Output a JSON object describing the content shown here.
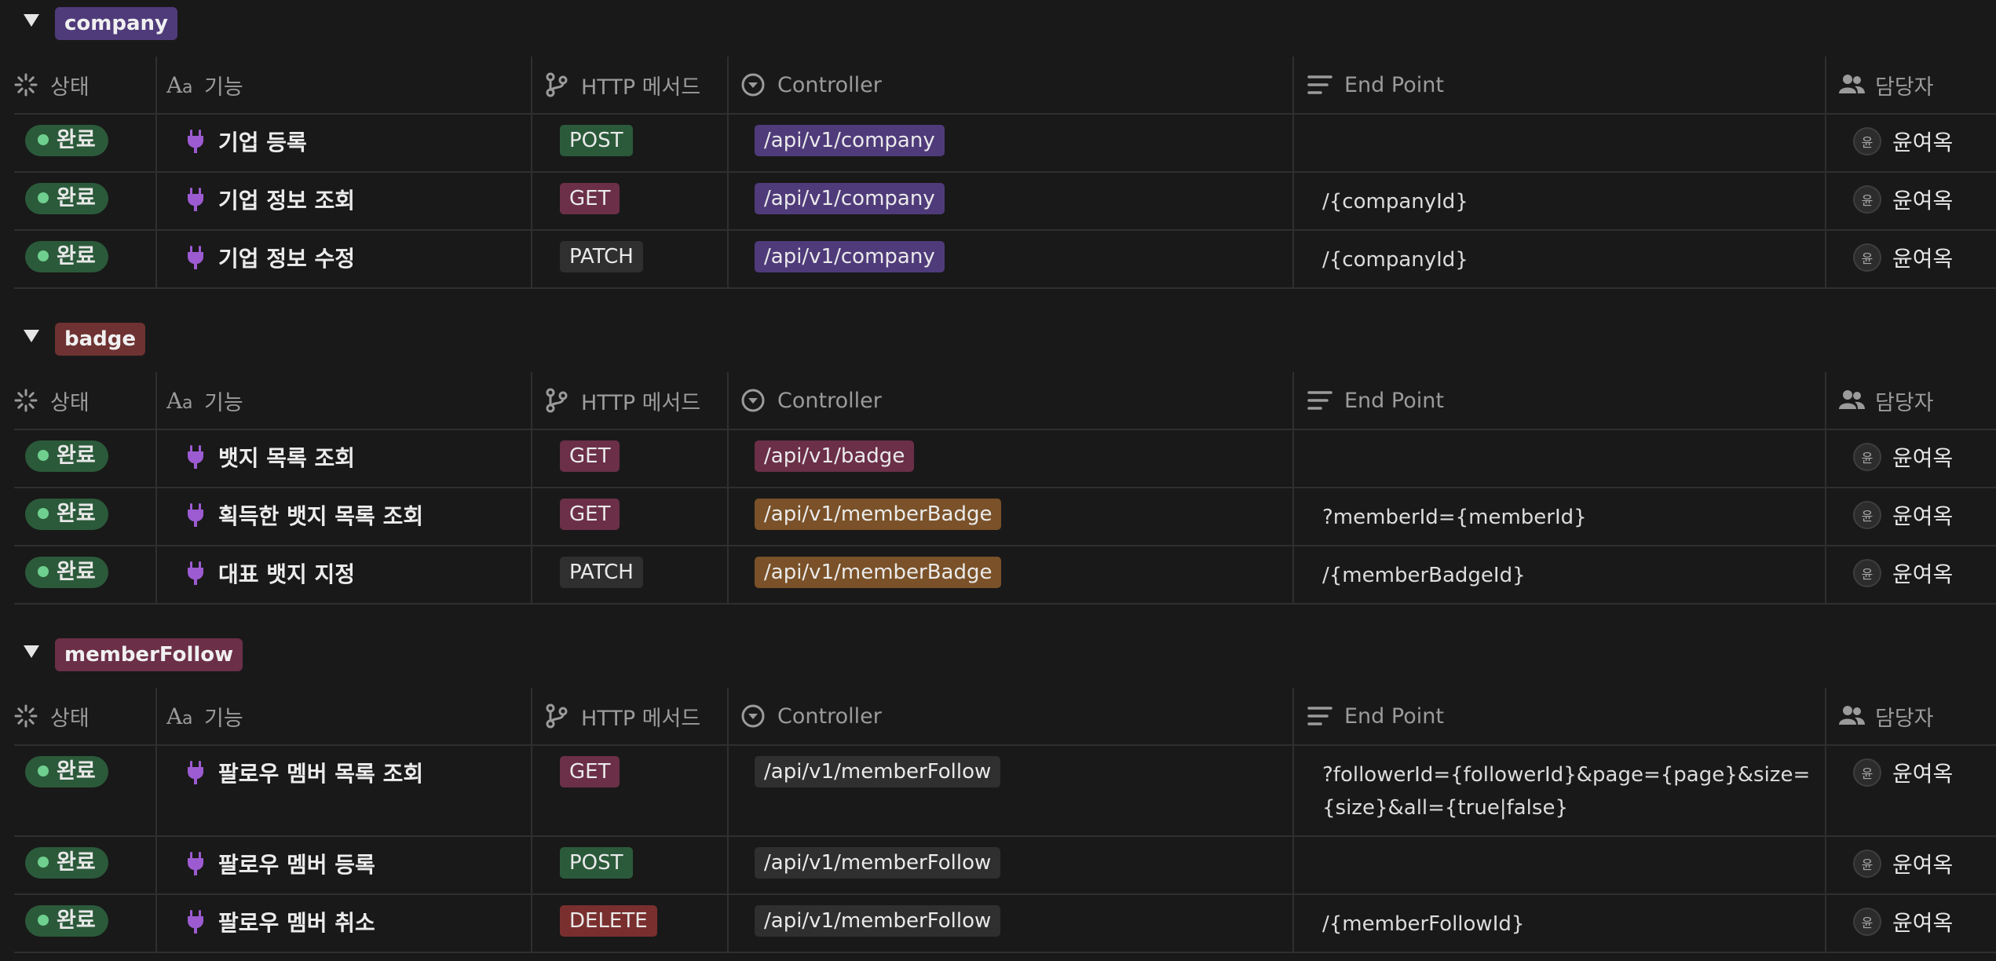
{
  "columns": {
    "status": "상태",
    "feature": "기능",
    "method": "HTTP 메서드",
    "controller": "Controller",
    "endpoint": "End Point",
    "assignee": "담당자"
  },
  "colors": {
    "background": "#191919",
    "status_done_bg": "#2b5a3a",
    "status_done_dot": "#6fcf8e",
    "plug_icon": "#9d5bd2",
    "method_post": "#2b5a3a",
    "method_get": "#6b2f47",
    "method_patch": "#2f2f2f",
    "method_delete": "#7a2f2f",
    "controller_company": "#4f3b7a",
    "controller_badge": "#6b2f47",
    "controller_memberBadge": "#7a5128",
    "controller_memberFollow": "#2f2f2f",
    "group_company": "#4f3b7a",
    "group_badge": "#6e3232",
    "group_memberFollow": "#6b2f47"
  },
  "groups": [
    {
      "name": "company",
      "rows": [
        {
          "status": "완료",
          "feature": "기업 등록",
          "method": "POST",
          "controller": "/api/v1/company",
          "endpoint": "",
          "assignee": "윤여옥",
          "avatar": "윤"
        },
        {
          "status": "완료",
          "feature": "기업 정보 조회",
          "method": "GET",
          "controller": "/api/v1/company",
          "endpoint": "/{companyId}",
          "assignee": "윤여옥",
          "avatar": "윤"
        },
        {
          "status": "완료",
          "feature": "기업 정보 수정",
          "method": "PATCH",
          "controller": "/api/v1/company",
          "endpoint": "/{companyId}",
          "assignee": "윤여옥",
          "avatar": "윤"
        }
      ]
    },
    {
      "name": "badge",
      "rows": [
        {
          "status": "완료",
          "feature": "뱃지 목록 조회",
          "method": "GET",
          "controller": "/api/v1/badge",
          "endpoint": "",
          "assignee": "윤여옥",
          "avatar": "윤"
        },
        {
          "status": "완료",
          "feature": "획득한 뱃지 목록 조회",
          "method": "GET",
          "controller": "/api/v1/memberBadge",
          "endpoint": "?memberId={memberId}",
          "assignee": "윤여옥",
          "avatar": "윤"
        },
        {
          "status": "완료",
          "feature": "대표 뱃지 지정",
          "method": "PATCH",
          "controller": "/api/v1/memberBadge",
          "endpoint": "/{memberBadgeId}",
          "assignee": "윤여옥",
          "avatar": "윤"
        }
      ]
    },
    {
      "name": "memberFollow",
      "rows": [
        {
          "status": "완료",
          "feature": "팔로우 멤버 목록 조회",
          "method": "GET",
          "controller": "/api/v1/memberFollow",
          "endpoint": "?followerId={followerId}&page={page}&size={size}&all={true|false}",
          "assignee": "윤여옥",
          "avatar": "윤"
        },
        {
          "status": "완료",
          "feature": "팔로우 멤버 등록",
          "method": "POST",
          "controller": "/api/v1/memberFollow",
          "endpoint": "",
          "assignee": "윤여옥",
          "avatar": "윤"
        },
        {
          "status": "완료",
          "feature": "팔로우 멤버 취소",
          "method": "DELETE",
          "controller": "/api/v1/memberFollow",
          "endpoint": "/{memberFollowId}",
          "assignee": "윤여옥",
          "avatar": "윤"
        }
      ]
    }
  ]
}
